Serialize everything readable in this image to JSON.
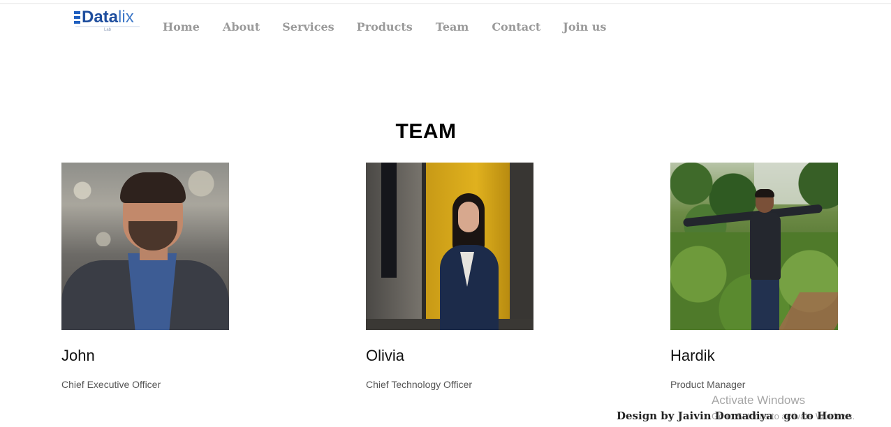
{
  "header": {
    "logo": {
      "text_bold": "Data",
      "text_light": "lix",
      "subtext": "Lab"
    },
    "nav": [
      {
        "label": "Home"
      },
      {
        "label": "About"
      },
      {
        "label": "Services"
      },
      {
        "label": "Products"
      },
      {
        "label": "Team"
      },
      {
        "label": "Contact"
      },
      {
        "label": "Join us"
      }
    ]
  },
  "main": {
    "section_title": "TEAM",
    "members": [
      {
        "name": "John",
        "role": "Chief Executive Officer"
      },
      {
        "name": "Olivia",
        "role": "Chief Technology Officer"
      },
      {
        "name": "Hardik",
        "role": "Product Manager"
      }
    ]
  },
  "footer": {
    "credit": "Design by Jaivin Domadiya",
    "home_link": "go to Home"
  },
  "watermark": {
    "line1": "Activate Windows",
    "line2": "Go to Settings to activate Windows."
  },
  "colors": {
    "brand_primary": "#1f4e9e",
    "brand_light": "#3f79c8",
    "nav_text": "#9a9a9a"
  }
}
